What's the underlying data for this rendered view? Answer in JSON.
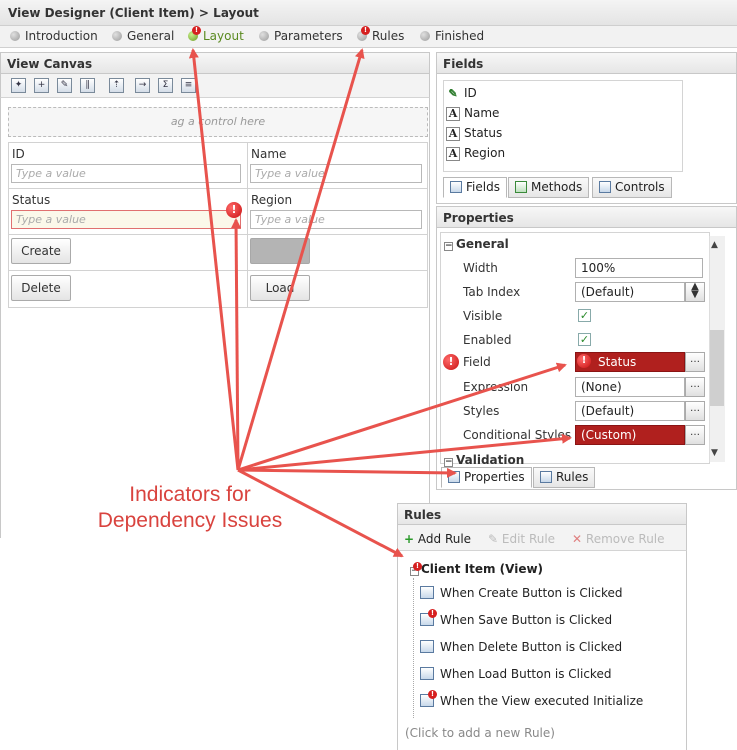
{
  "title": "View Designer (Client Item) > Layout",
  "steps": [
    {
      "label": "Introduction",
      "active": false,
      "warning": false
    },
    {
      "label": "General",
      "active": false,
      "warning": false
    },
    {
      "label": "Layout",
      "active": true,
      "warning": true
    },
    {
      "label": "Parameters",
      "active": false,
      "warning": false
    },
    {
      "label": "Rules",
      "active": false,
      "warning": true
    },
    {
      "label": "Finished",
      "active": false,
      "warning": false
    }
  ],
  "canvas": {
    "title": "View Canvas",
    "dropzone": "ag a control here",
    "fields": {
      "id_label": "ID",
      "name_label": "Name",
      "status_label": "Status",
      "region_label": "Region",
      "placeholder": "Type a value"
    },
    "buttons": {
      "create": "Create",
      "delete": "Delete",
      "load": "Load"
    }
  },
  "fields_panel": {
    "title": "Fields",
    "items": [
      "ID",
      "Name",
      "Status",
      "Region"
    ],
    "tabs": [
      "Fields",
      "Methods",
      "Controls"
    ]
  },
  "properties": {
    "title": "Properties",
    "general": "General",
    "rows": [
      {
        "label": "Width",
        "value": "100%"
      },
      {
        "label": "Tab Index",
        "value": "(Default)"
      },
      {
        "label": "Visible",
        "value": ""
      },
      {
        "label": "Enabled",
        "value": ""
      },
      {
        "label": "Field",
        "value": "Status"
      },
      {
        "label": "Expression",
        "value": "(None)"
      },
      {
        "label": "Styles",
        "value": "(Default)"
      },
      {
        "label": "Conditional Styles",
        "value": "(Custom)"
      }
    ],
    "validation": "Validation",
    "tabs": [
      "Properties",
      "Rules"
    ]
  },
  "rules": {
    "title": "Rules",
    "toolbar": [
      "Add Rule",
      "Edit Rule",
      "Remove Rule"
    ],
    "root": "Client Item (View)",
    "items": [
      "When Create Button is Clicked",
      "When Save Button is Clicked",
      "When Delete Button is Clicked",
      "When Load Button is Clicked",
      "When the View executed Initialize"
    ],
    "hint": "(Click to add a new Rule)"
  },
  "annotation": {
    "line1": "Indicators for",
    "line2": "Dependency Issues"
  },
  "colors": {
    "accent": "#d9433e",
    "error": "#b0201e",
    "active_step": "#5a8a20"
  }
}
